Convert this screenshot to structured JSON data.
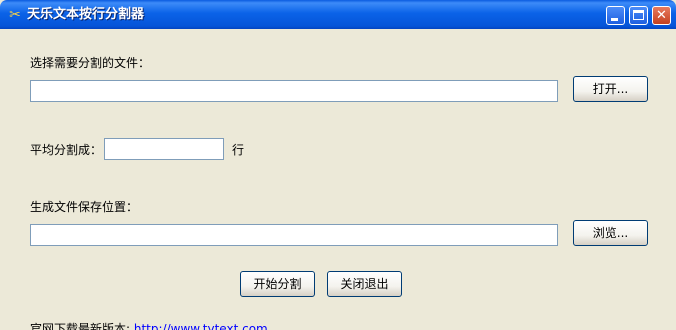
{
  "window": {
    "title": "天乐文本按行分割器"
  },
  "file_section": {
    "label": "选择需要分割的文件：",
    "file_value": "",
    "open_button": "打开..."
  },
  "split_section": {
    "label": "平均分割成：",
    "lines_value": "",
    "unit": "行"
  },
  "output_section": {
    "label": "生成文件保存位置：",
    "path_value": "",
    "browse_button": "浏览..."
  },
  "actions": {
    "start_button": "开始分割",
    "exit_button": "关闭退出"
  },
  "footer": {
    "prefix": "官网下载最新版本:",
    "url": "http://www.tytext.com"
  }
}
